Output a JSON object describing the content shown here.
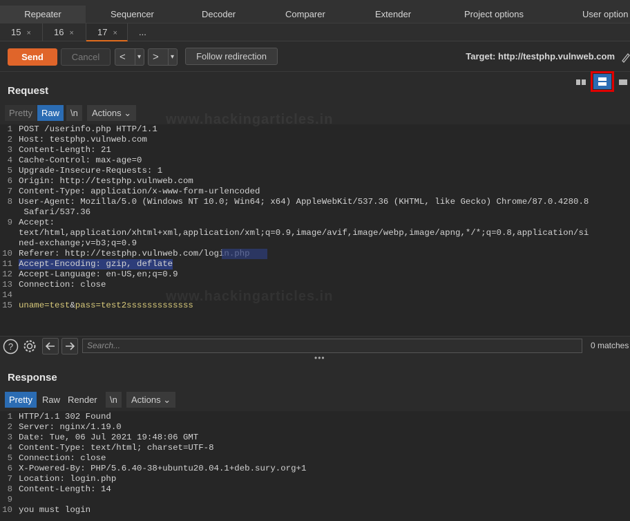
{
  "top_tabs": [
    "Repeater",
    "Sequencer",
    "Decoder",
    "Comparer",
    "Extender",
    "Project options",
    "User option"
  ],
  "sub_tabs": [
    {
      "label": "15",
      "close": "×"
    },
    {
      "label": "16",
      "close": "×"
    },
    {
      "label": "17",
      "close": "×"
    },
    {
      "label": "..."
    }
  ],
  "toolbar": {
    "send": "Send",
    "cancel": "Cancel",
    "back": "<",
    "forward": ">",
    "dropdown": "▾",
    "follow": "Follow redirection",
    "target_label": "Target: http://testphp.vulnweb.com"
  },
  "request": {
    "title": "Request",
    "tabs": [
      "Pretty",
      "Raw",
      "\\n",
      "Actions ⌄"
    ],
    "lines": [
      {
        "n": "1",
        "t": "POST /userinfo.php HTTP/1.1"
      },
      {
        "n": "2",
        "t": "Host: testphp.vulnweb.com"
      },
      {
        "n": "3",
        "t": "Content-Length: 21"
      },
      {
        "n": "4",
        "t": "Cache-Control: max-age=0"
      },
      {
        "n": "5",
        "t": "Upgrade-Insecure-Requests: 1"
      },
      {
        "n": "6",
        "t": "Origin: http://testphp.vulnweb.com"
      },
      {
        "n": "7",
        "t": "Content-Type: application/x-www-form-urlencoded"
      },
      {
        "n": "8",
        "t": "User-Agent: Mozilla/5.0 (Windows NT 10.0; Win64; x64) AppleWebKit/537.36 (KHTML, like Gecko) Chrome/87.0.4280.8"
      },
      {
        "n": "",
        "t": " Safari/537.36"
      },
      {
        "n": "9",
        "t": "Accept:"
      },
      {
        "n": "",
        "t": "text/html,application/xhtml+xml,application/xml;q=0.9,image/avif,image/webp,image/apng,*/*;q=0.8,application/si"
      },
      {
        "n": "",
        "t": "ned-exchange;v=b3;q=0.9"
      },
      {
        "n": "10",
        "t": "Referer: http://testphp.vulnweb.com/login.php"
      },
      {
        "n": "11",
        "t": "Accept-Encoding: gzip, deflate"
      },
      {
        "n": "12",
        "t": "Accept-Language: en-US,en;q=0.9"
      },
      {
        "n": "13",
        "t": "Connection: close"
      },
      {
        "n": "14",
        "t": ""
      },
      {
        "n": "15",
        "t": "uname=test&pass=test2sssssssssssss"
      }
    ],
    "body_param_1": "uname=test",
    "body_amp": "&",
    "body_param_2": "pass=test2sssssssssssss"
  },
  "search": {
    "placeholder": "Search...",
    "matches": "0 matches"
  },
  "response": {
    "title": "Response",
    "tabs": [
      "Pretty",
      "Raw",
      "Render",
      "\\n",
      "Actions ⌄"
    ],
    "lines": [
      {
        "n": "1",
        "t": "HTTP/1.1 302 Found"
      },
      {
        "n": "2",
        "t": "Server: nginx/1.19.0"
      },
      {
        "n": "3",
        "t": "Date: Tue, 06 Jul 2021 19:48:06 GMT"
      },
      {
        "n": "4",
        "t": "Content-Type: text/html; charset=UTF-8"
      },
      {
        "n": "5",
        "t": "Connection: close"
      },
      {
        "n": "6",
        "t": "X-Powered-By: PHP/5.6.40-38+ubuntu20.04.1+deb.sury.org+1"
      },
      {
        "n": "7",
        "t": "Location: login.php"
      },
      {
        "n": "8",
        "t": "Content-Length: 14"
      },
      {
        "n": "9",
        "t": ""
      },
      {
        "n": "10",
        "t": "you must login"
      }
    ]
  },
  "watermark": "www.hackingarticles.in",
  "colors": {
    "accent": "#e0652a",
    "selected_tab": "#2b6cb3",
    "highlight_box": "#e00000"
  }
}
